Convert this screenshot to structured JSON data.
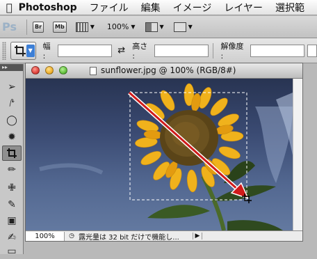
{
  "menubar": {
    "apple_icon": "apple-icon",
    "app_name": "Photoshop",
    "items": [
      "ファイル",
      "編集",
      "イメージ",
      "レイヤー",
      "選択範"
    ]
  },
  "appbar": {
    "logo": "Ps",
    "bridge_label": "Br",
    "minibridge_label": "Mb",
    "zoom_value": "100%"
  },
  "optionsbar": {
    "width_label": "幅 :",
    "height_label": "高さ :",
    "resolution_label": "解像度 :",
    "width_value": "",
    "height_value": "",
    "resolution_value": ""
  },
  "document": {
    "title": "sunflower.jpg @ 100% (RGB/8#)",
    "zoom": "100%",
    "status_message": "露光量は 32 bit だけで機能し..."
  },
  "colors": {
    "sky_top": "#283452",
    "sky_bottom": "#6379a0",
    "petal": "#f0b21c",
    "center": "#5a4418",
    "leaf": "#2f4a1f",
    "arrow": "#d01b1b",
    "close_light": "#e0443e",
    "minimize_light": "#f0b12f",
    "zoom_light": "#64c23f"
  }
}
